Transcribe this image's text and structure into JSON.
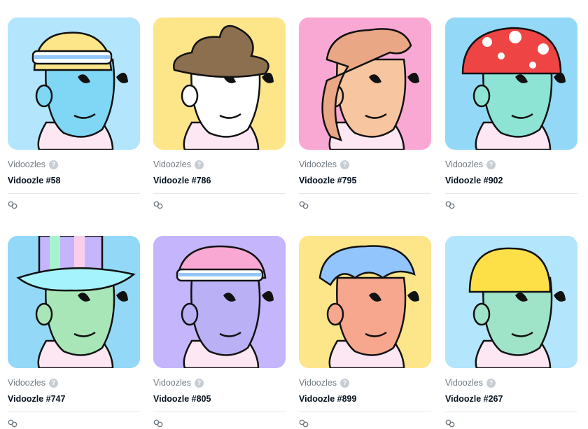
{
  "items": [
    {
      "collection": "Vidoozles",
      "name": "Vidoozle #58",
      "bg": "#b3e5fc",
      "skin": "#7fd6f5",
      "hat": "headband-blond"
    },
    {
      "collection": "Vidoozles",
      "name": "Vidoozle #786",
      "bg": "#fde58a",
      "skin": "#ffffff",
      "hat": "poop"
    },
    {
      "collection": "Vidoozles",
      "name": "Vidoozle #795",
      "bg": "#f9a8d4",
      "skin": "#f7c59f",
      "hat": "wavy-hair"
    },
    {
      "collection": "Vidoozles",
      "name": "Vidoozle #902",
      "bg": "#93d9f7",
      "skin": "#8de3d4",
      "hat": "mushroom"
    },
    {
      "collection": "Vidoozles",
      "name": "Vidoozle #747",
      "bg": "#93d9f7",
      "skin": "#a8e6b8",
      "hat": "holo-tophat"
    },
    {
      "collection": "Vidoozles",
      "name": "Vidoozle #805",
      "bg": "#c4b5fd",
      "skin": "#b9b0f5",
      "hat": "headband-pink"
    },
    {
      "collection": "Vidoozles",
      "name": "Vidoozle #899",
      "bg": "#fde58a",
      "skin": "#f8a78f",
      "hat": "blue-hair"
    },
    {
      "collection": "Vidoozles",
      "name": "Vidoozle #267",
      "bg": "#b3e5fc",
      "skin": "#9fe3c9",
      "hat": "yellow-bowl"
    }
  ],
  "verified_mark": "?"
}
